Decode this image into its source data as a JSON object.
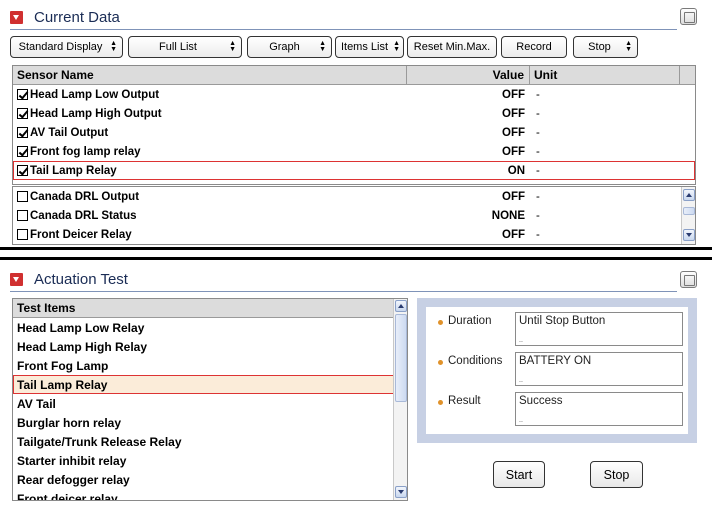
{
  "current_data": {
    "title": "Current Data",
    "toolbar": [
      {
        "label": "Standard Display",
        "dropdown": true
      },
      {
        "label": "Full List",
        "dropdown": true
      },
      {
        "label": "Graph",
        "dropdown": true
      },
      {
        "label": "Items List",
        "dropdown": true
      },
      {
        "label": "Reset Min.Max.",
        "dropdown": false
      },
      {
        "label": "Record",
        "dropdown": false
      },
      {
        "label": "Stop",
        "dropdown": true
      }
    ],
    "columns": {
      "name": "Sensor Name",
      "value": "Value",
      "unit": "Unit"
    },
    "pinned_rows": [
      {
        "name": "Head Lamp Low Output",
        "value": "OFF",
        "unit": "-",
        "checked": true
      },
      {
        "name": "Head Lamp High Output",
        "value": "OFF",
        "unit": "-",
        "checked": true
      },
      {
        "name": "AV Tail Output",
        "value": "OFF",
        "unit": "-",
        "checked": true
      },
      {
        "name": "Front fog lamp relay",
        "value": "OFF",
        "unit": "-",
        "checked": true
      },
      {
        "name": "Tail Lamp Relay",
        "value": "ON",
        "unit": "-",
        "checked": true,
        "highlighted": true
      }
    ],
    "rows": [
      {
        "name": "Canada DRL Output",
        "value": "OFF",
        "unit": "-",
        "checked": false
      },
      {
        "name": "Canada DRL Status",
        "value": "NONE",
        "unit": "-",
        "checked": false
      },
      {
        "name": "Front Deicer Relay",
        "value": "OFF",
        "unit": "-",
        "checked": false
      }
    ]
  },
  "actuation_test": {
    "title": "Actuation Test",
    "list_header": "Test Items",
    "items": [
      {
        "label": "Head Lamp Low Relay"
      },
      {
        "label": "Head Lamp High Relay"
      },
      {
        "label": "Front Fog Lamp"
      },
      {
        "label": "Tail Lamp Relay",
        "selected": true
      },
      {
        "label": "AV Tail"
      },
      {
        "label": "Burglar horn relay"
      },
      {
        "label": "Tailgate/Trunk Release Relay"
      },
      {
        "label": "Starter inhibit relay"
      },
      {
        "label": "Rear defogger relay"
      },
      {
        "label": "Front deicer relay"
      }
    ],
    "details": [
      {
        "label": "Duration",
        "value": "Until Stop Button"
      },
      {
        "label": "Conditions",
        "value": "BATTERY ON"
      },
      {
        "label": "Result",
        "value": "Success"
      }
    ],
    "start_label": "Start",
    "stop_label": "Stop"
  },
  "colors": {
    "accent_red": "#d03030",
    "title_blue": "#1a2c55",
    "bullet_orange": "#e0922a",
    "panel_blue": "#c7d0e4",
    "selection": "#fbecd9"
  }
}
